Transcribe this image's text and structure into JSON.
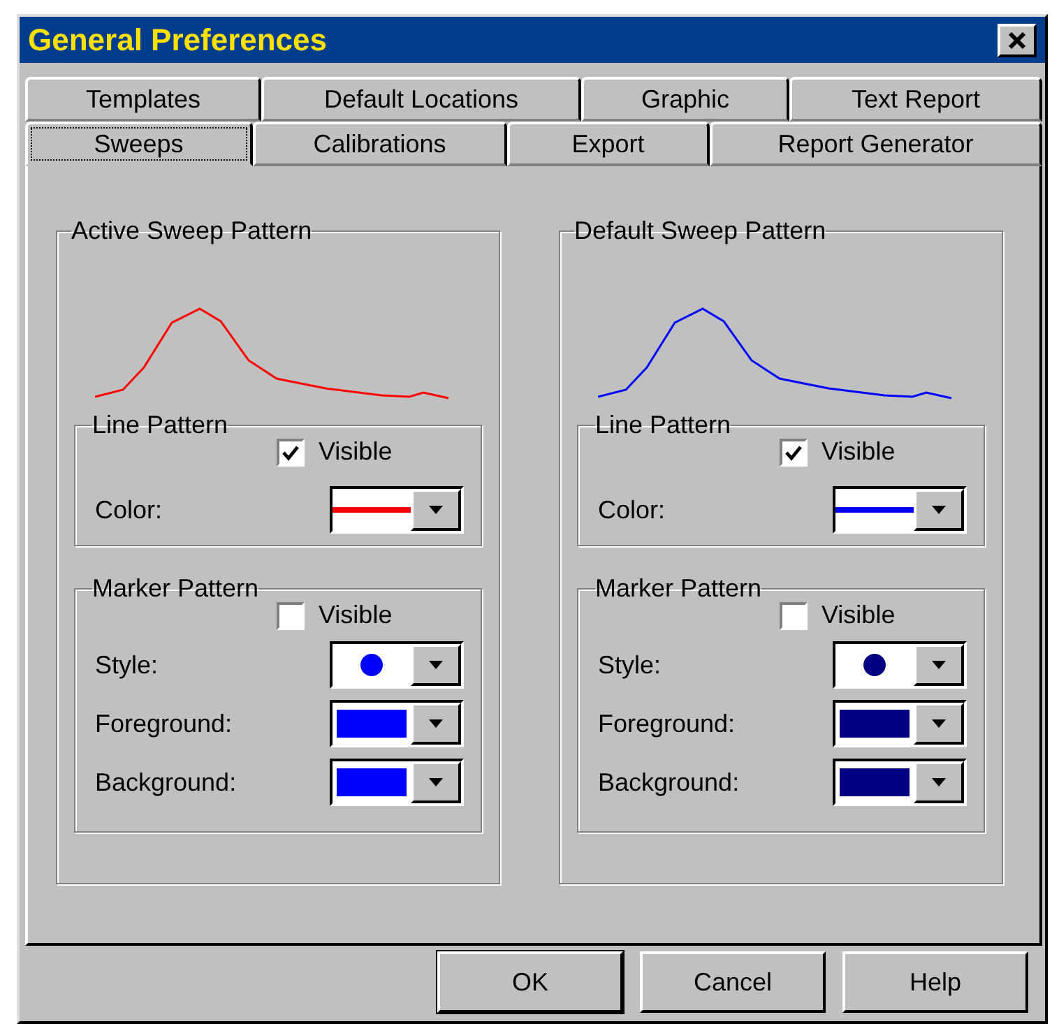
{
  "window": {
    "title": "General Preferences"
  },
  "tab_rows": [
    [
      {
        "label": "Templates",
        "selected": false
      },
      {
        "label": "Default Locations",
        "selected": false
      },
      {
        "label": "Graphic",
        "selected": false
      },
      {
        "label": "Text Report",
        "selected": false
      }
    ],
    [
      {
        "label": "Sweeps",
        "selected": true
      },
      {
        "label": "Calibrations",
        "selected": false
      },
      {
        "label": "Export",
        "selected": false
      },
      {
        "label": "Report Generator",
        "selected": false
      }
    ]
  ],
  "panels": [
    {
      "title": "Active Sweep Pattern",
      "line_pattern": {
        "title": "Line Pattern",
        "visible": {
          "label": "Visible",
          "checked": true
        },
        "color_label": "Color:",
        "color": "#ff0000"
      },
      "marker_pattern": {
        "title": "Marker Pattern",
        "visible": {
          "label": "Visible",
          "checked": false
        },
        "fields": [
          {
            "label": "Style:",
            "kind": "marker",
            "color": "#0000ff"
          },
          {
            "label": "Foreground:",
            "kind": "swatch",
            "color": "#0000ff"
          },
          {
            "label": "Background:",
            "kind": "swatch",
            "color": "#0000ff"
          }
        ]
      }
    },
    {
      "title": "Default Sweep Pattern",
      "line_pattern": {
        "title": "Line Pattern",
        "visible": {
          "label": "Visible",
          "checked": true
        },
        "color_label": "Color:",
        "color": "#0000ff"
      },
      "marker_pattern": {
        "title": "Marker Pattern",
        "visible": {
          "label": "Visible",
          "checked": false
        },
        "fields": [
          {
            "label": "Style:",
            "kind": "marker",
            "color": "#000080"
          },
          {
            "label": "Foreground:",
            "kind": "swatch",
            "color": "#000080"
          },
          {
            "label": "Background:",
            "kind": "swatch",
            "color": "#000080"
          }
        ]
      }
    }
  ],
  "buttons": [
    {
      "label": "OK"
    },
    {
      "label": "Cancel"
    },
    {
      "label": "Help"
    }
  ]
}
